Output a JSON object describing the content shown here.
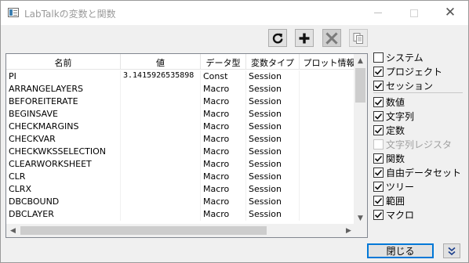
{
  "window": {
    "title": "LabTalkの変数と関数"
  },
  "toolbar": {
    "refresh_icon": "refresh-icon",
    "add_icon": "plus-icon",
    "delete_icon": "x-icon",
    "copy_icon": "copy-icon"
  },
  "table": {
    "columns": [
      "名前",
      "値",
      "データ型",
      "変数タイプ",
      "プロット情報"
    ],
    "rows": [
      [
        "PI",
        "3.1415926535898",
        "Const",
        "Session",
        ""
      ],
      [
        "ARRANGELAYERS",
        "",
        "Macro",
        "Session",
        ""
      ],
      [
        "BEFOREITERATE",
        "",
        "Macro",
        "Session",
        ""
      ],
      [
        "BEGINSAVE",
        "",
        "Macro",
        "Session",
        ""
      ],
      [
        "CHECKMARGINS",
        "",
        "Macro",
        "Session",
        ""
      ],
      [
        "CHECKVAR",
        "",
        "Macro",
        "Session",
        ""
      ],
      [
        "CHECKWKSSELECTION",
        "",
        "Macro",
        "Session",
        ""
      ],
      [
        "CLEARWORKSHEET",
        "",
        "Macro",
        "Session",
        ""
      ],
      [
        "CLR",
        "",
        "Macro",
        "Session",
        ""
      ],
      [
        "CLRX",
        "",
        "Macro",
        "Session",
        ""
      ],
      [
        "DBCBOUND",
        "",
        "Macro",
        "Session",
        ""
      ],
      [
        "DBCLAYER",
        "",
        "Macro",
        "Session",
        ""
      ]
    ]
  },
  "options": {
    "scope": [
      {
        "label": "システム",
        "checked": false,
        "enabled": true
      },
      {
        "label": "プロジェクト",
        "checked": true,
        "enabled": true
      },
      {
        "label": "セッション",
        "checked": true,
        "enabled": true
      }
    ],
    "types": [
      {
        "label": "数値",
        "checked": true,
        "enabled": true
      },
      {
        "label": "文字列",
        "checked": true,
        "enabled": true
      },
      {
        "label": "定数",
        "checked": true,
        "enabled": true
      },
      {
        "label": "文字列レジスタ",
        "checked": false,
        "enabled": false
      },
      {
        "label": "関数",
        "checked": true,
        "enabled": true
      },
      {
        "label": "自由データセット",
        "checked": true,
        "enabled": true
      },
      {
        "label": "ツリー",
        "checked": true,
        "enabled": true
      },
      {
        "label": "範囲",
        "checked": true,
        "enabled": true
      },
      {
        "label": "マクロ",
        "checked": true,
        "enabled": true
      }
    ]
  },
  "footer": {
    "close_label": "閉じる"
  }
}
